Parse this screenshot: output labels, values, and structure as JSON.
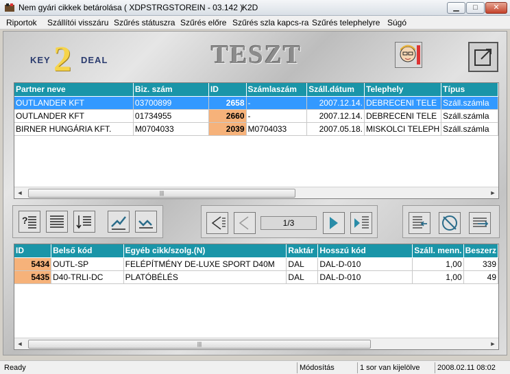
{
  "window": {
    "title": "Nem gyári cikkek betárolása ( XDPSTRGSTOREIN - 03.142 )",
    "app_code": "K2D",
    "min_label": "▁",
    "max_label": "□",
    "close_label": "✕"
  },
  "menu": {
    "items": [
      "Riportok",
      "Szállítói visszáru",
      "Szűrés státuszra",
      "Szűrés előre",
      "Szűrés szla kapcs-ra",
      "Szűrés telephelyre",
      "Súgó"
    ]
  },
  "logo": {
    "left": "KEY",
    "digit": "2",
    "right": "DEAL"
  },
  "banner": {
    "text": "TESZT"
  },
  "top_grid": {
    "columns": [
      "Partner neve",
      "Biz. szám",
      "ID",
      "Számlaszám",
      "Száll.dátum",
      "Telephely",
      "Típus"
    ],
    "rows": [
      [
        "OUTLANDER KFT",
        "03700899",
        "2658",
        "-",
        "2007.12.14.",
        "DEBRECENI TELE",
        "Száll.számla"
      ],
      [
        "OUTLANDER KFT",
        "01734955",
        "2660",
        "-",
        "2007.12.14.",
        "DEBRECENI TELE",
        "Száll.számla"
      ],
      [
        "BIRNER HUNGÁRIA KFT.",
        "M0704033",
        "2039",
        "M0704033",
        "2007.05.18.",
        "MISKOLCI TELEPH",
        "Száll.számla"
      ]
    ],
    "selected_row": 0
  },
  "pager": {
    "text": "1/3"
  },
  "bottom_grid": {
    "columns": [
      "ID",
      "Belső kód",
      "Egyéb cikk/szolg.(N)",
      "Raktár",
      "Hosszú kód",
      "Száll. menn.",
      "Beszerz"
    ],
    "rows": [
      [
        "5434",
        "OUTL-SP",
        "FELÉPÍTMÉNY DE-LUXE SPORT D40M",
        "DAL",
        "DAL-D-010",
        "1,00",
        "339"
      ],
      [
        "5435",
        "D40-TRLI-DC",
        "PLATÓBÉLÉS",
        "DAL",
        "DAL-D-010",
        "1,00",
        "49"
      ]
    ]
  },
  "status": {
    "ready": "Ready",
    "mode": "Módosítás",
    "selection": "1 sor van kijelölve",
    "datetime": "2008.02.11 08:02"
  },
  "colors": {
    "header": "#1a95a8",
    "selected": "#3399ff",
    "id_cell": "#f6b27a"
  }
}
